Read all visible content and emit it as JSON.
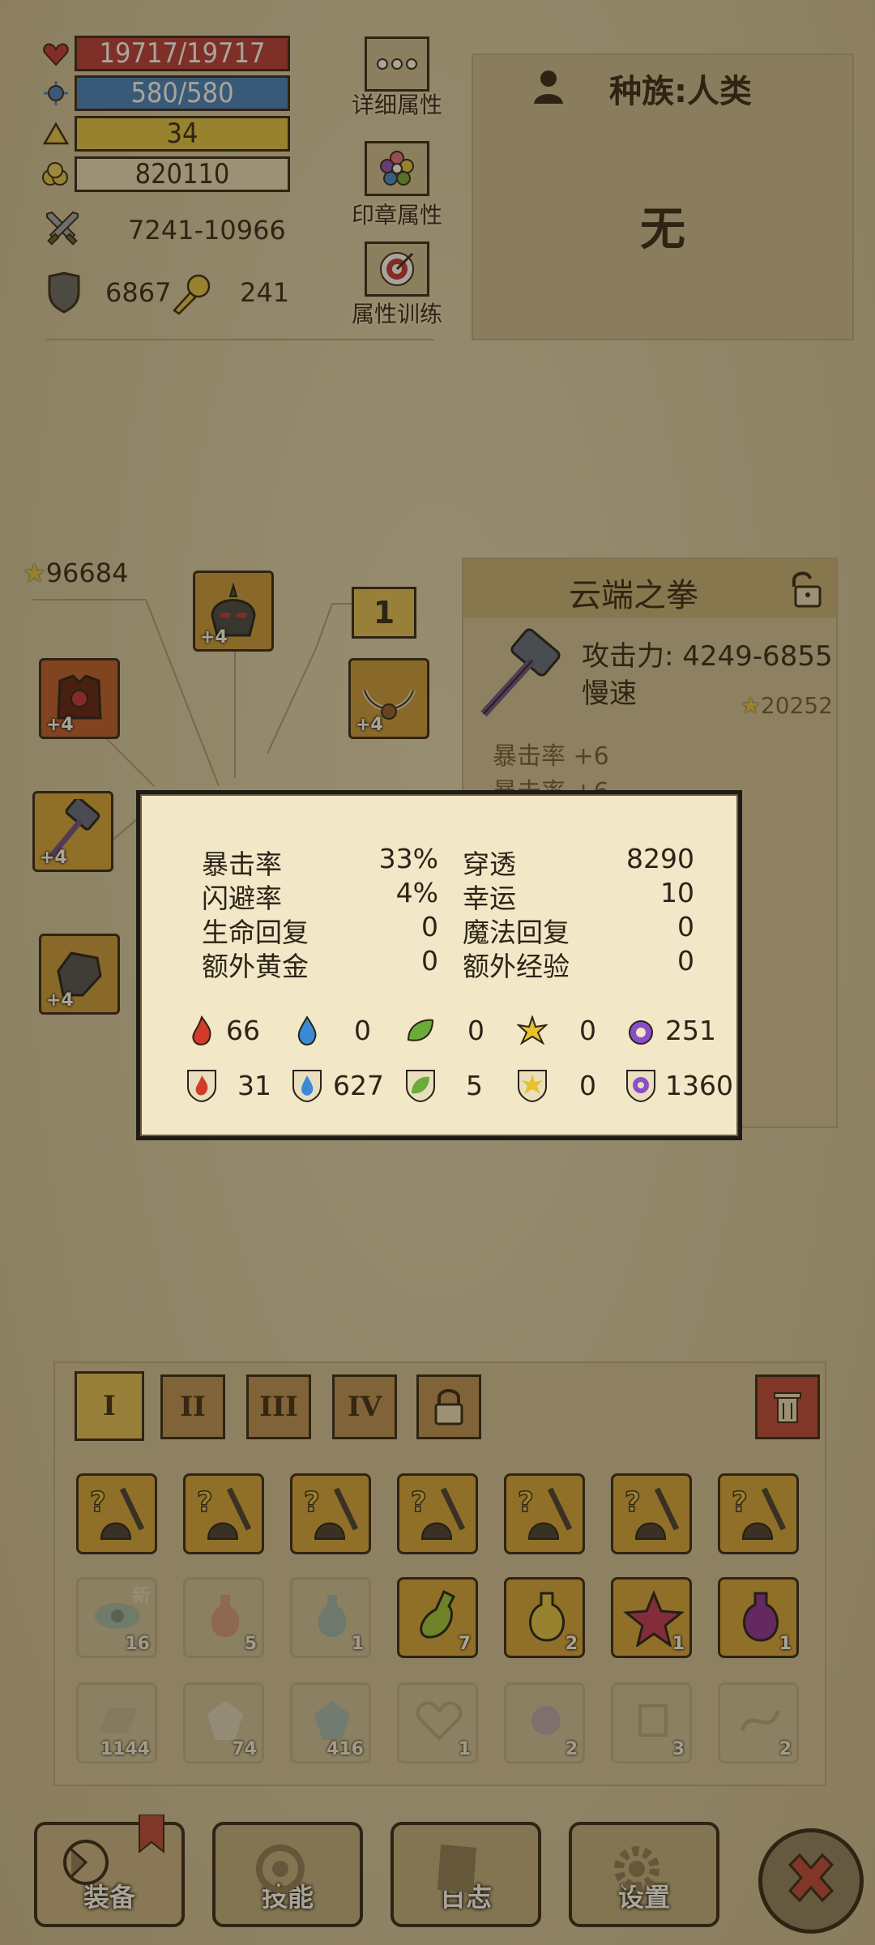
{
  "stats": {
    "hp": "19717/19717",
    "mp": "580/580",
    "level": "34",
    "gold": "820110",
    "attack": "7241-10966",
    "defense": "6867",
    "power": "241"
  },
  "side_buttons": {
    "detail": "详细属性",
    "seal": "印章属性",
    "training": "属性训练"
  },
  "race": {
    "label": "种族:人类",
    "value": "无"
  },
  "equipment": {
    "score": "96684",
    "slot_badge": "1",
    "slots": [
      {
        "name": "helmet",
        "level": "+4"
      },
      {
        "name": "armor",
        "level": "+4"
      },
      {
        "name": "necklace",
        "level": "+4"
      },
      {
        "name": "weapon",
        "level": "+4"
      },
      {
        "name": "gloves",
        "level": "+4"
      }
    ]
  },
  "item": {
    "name": "云端之拳",
    "attack": "攻击力: 4249-6855",
    "speed": "慢速",
    "score": "20252",
    "affixes": [
      "暴击率 +6",
      "暴击率 +6"
    ]
  },
  "tooltip": {
    "rows": [
      {
        "l1": "暴击率",
        "v1": "33%",
        "l2": "穿透",
        "v2": "8290"
      },
      {
        "l1": "闪避率",
        "v1": "4%",
        "l2": "幸运",
        "v2": "10"
      },
      {
        "l1": "生命回复",
        "v1": "0",
        "l2": "魔法回复",
        "v2": "0"
      },
      {
        "l1": "额外黄金",
        "v1": "0",
        "l2": "额外经验",
        "v2": "0"
      }
    ],
    "attack_elements": [
      "66",
      "0",
      "0",
      "0",
      "251"
    ],
    "resist_elements": [
      "31",
      "627",
      "5",
      "0",
      "1360"
    ],
    "element_colors": [
      "#d23a2a",
      "#3a8ad6",
      "#6bab3a",
      "#e8c12e",
      "#8a4ec8"
    ]
  },
  "bag_tabs": [
    "I",
    "II",
    "III",
    "IV"
  ],
  "inventory": {
    "row2": [
      {
        "count": "16",
        "badge": "新"
      },
      {
        "count": "5"
      },
      {
        "count": "1"
      },
      {
        "count": "7"
      },
      {
        "count": "2"
      },
      {
        "count": "1"
      },
      {
        "count": "1"
      }
    ],
    "row3": [
      "1144",
      "74",
      "416",
      "1",
      "2",
      "3",
      "2"
    ]
  },
  "bottom_nav": {
    "equip": "装备",
    "skill": "技能",
    "log": "日志",
    "settings": "设置"
  }
}
